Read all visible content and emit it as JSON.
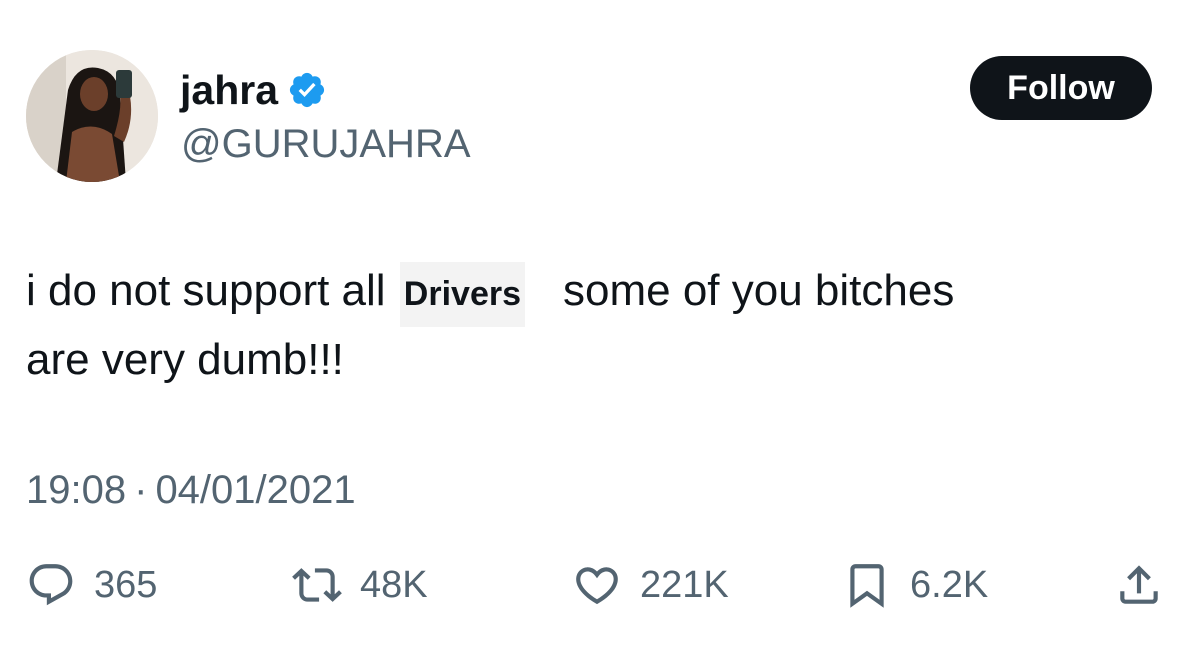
{
  "author": {
    "display_name": "jahra",
    "handle": "@GURUJAHRA",
    "verified_icon": "verified-badge-icon",
    "verified_color": "#1d9bf0"
  },
  "follow_label": "Follow",
  "tweet": {
    "text_part1": "i do not support all",
    "redaction_label": "Drivers",
    "text_part2": "some of you bitches",
    "text_line2": "are very dumb!!!"
  },
  "meta": {
    "time": "19:08",
    "separator": "·",
    "date": "04/01/2021"
  },
  "actions": {
    "replies": {
      "icon": "reply-icon",
      "count": "365"
    },
    "retweets": {
      "icon": "retweet-icon",
      "count": "48K"
    },
    "likes": {
      "icon": "heart-icon",
      "count": "221K"
    },
    "bookmarks": {
      "icon": "bookmark-icon",
      "count": "6.2K"
    },
    "share": {
      "icon": "share-icon"
    }
  },
  "colors": {
    "text_primary": "#0f1419",
    "text_secondary": "#536471",
    "follow_bg": "#0f1419",
    "follow_text": "#ffffff"
  }
}
